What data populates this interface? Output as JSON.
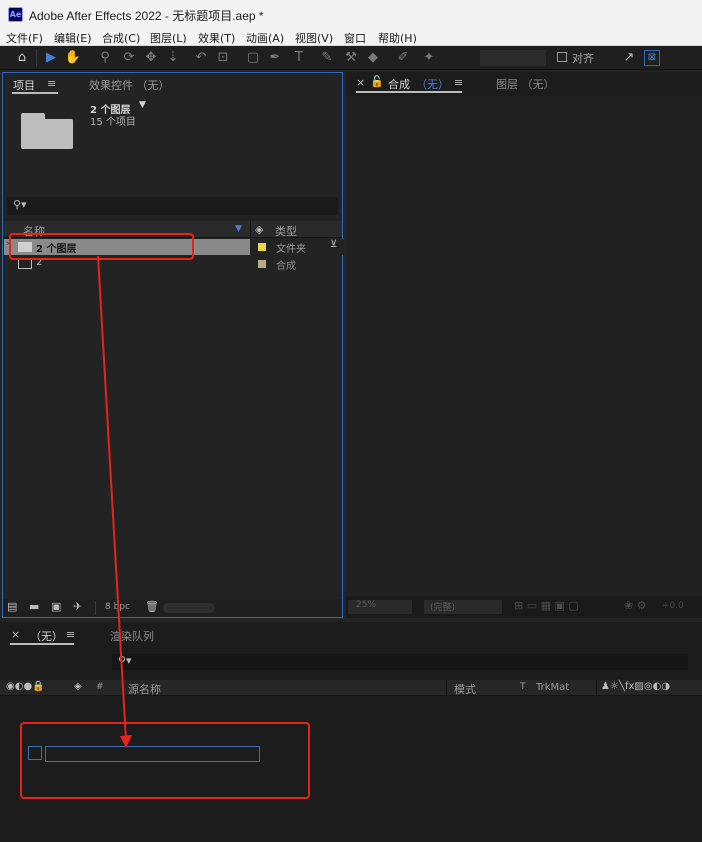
{
  "window": {
    "logo": "Ae",
    "title": "Adobe After Effects 2022 - 无标题项目.aep *"
  },
  "menu": [
    "文件(F)",
    "编辑(E)",
    "合成(C)",
    "图层(L)",
    "效果(T)",
    "动画(A)",
    "视图(V)",
    "窗口",
    "帮助(H)"
  ],
  "toolbar": {
    "tools": [
      "home-icon",
      "selection-icon",
      "hand-icon",
      "zoom-icon",
      "orbit-icon",
      "pan-icon",
      "dolly-icon",
      "rotate-icon",
      "camera-icon",
      "mask-icon",
      "pen-icon",
      "text-icon",
      "brush-icon",
      "stamp-icon",
      "eraser-icon",
      "roto-icon",
      "puppet-icon"
    ],
    "snap_label": "对齐"
  },
  "project_panel": {
    "tab_project": "项目",
    "tab_effects": "效果控件 （无）",
    "selection_name": "2 个图层",
    "selection_info": "15 个项目",
    "columns": {
      "name": "名称",
      "type": "类型"
    },
    "items": [
      {
        "name": "2 个图层",
        "label_color": "#e6d84a",
        "type": "文件夹",
        "selected": true
      },
      {
        "name": "2",
        "label_color": "#b9a789",
        "type": "合成",
        "selected": false
      }
    ],
    "bit_depth": "8 bpc"
  },
  "comp_panel": {
    "tab_comp_prefix": "合成",
    "tab_comp_value": "（无）",
    "tab_layer": "图层 （无）",
    "zoom": "25%",
    "resolution": "(完整)",
    "exposure": "+0.0"
  },
  "timeline_panel": {
    "tab_comp": "（无）",
    "tab_render": "渲染队列",
    "columns": {
      "hash": "#",
      "source": "源名称",
      "mode": "模式",
      "t": "T",
      "trkmat": "TrkMat"
    }
  },
  "colors": {
    "accent": "#2d69b5",
    "annotation": "#e8231b",
    "selection_row": "#8a8a8a"
  }
}
